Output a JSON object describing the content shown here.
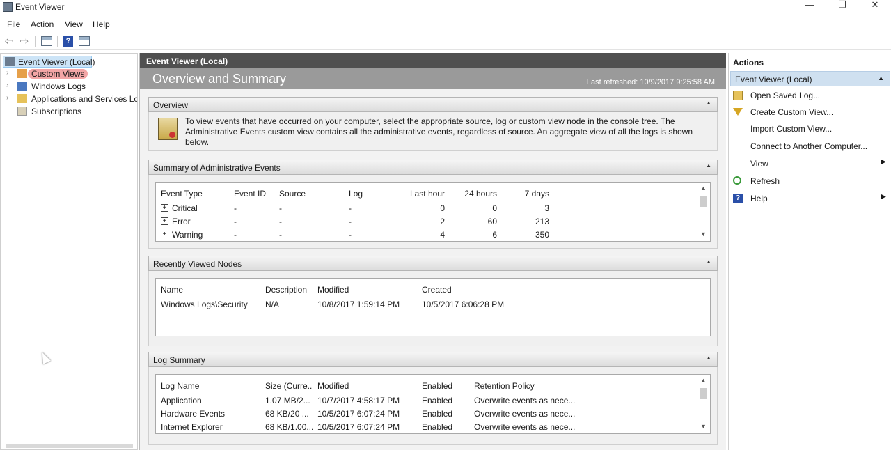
{
  "window": {
    "title": "Event Viewer",
    "minimize": "—",
    "restore": "❐",
    "close": "✕"
  },
  "menu": [
    "File",
    "Action",
    "View",
    "Help"
  ],
  "toolbar": {
    "back": "⇦",
    "forward": "⇨",
    "help": "?"
  },
  "tree": {
    "items": [
      {
        "label": "Event Viewer (Local)",
        "icon": "event-viewer-icon"
      },
      {
        "label": "Custom Views",
        "icon": "folder-icon"
      },
      {
        "label": "Windows Logs",
        "icon": "windows-logs-icon"
      },
      {
        "label": "Applications and Services Logs",
        "icon": "folder-icon"
      },
      {
        "label": "Subscriptions",
        "icon": "subscriptions-icon"
      }
    ],
    "expander": "›"
  },
  "center": {
    "header": "Event Viewer (Local)",
    "overview_title": "Overview and Summary",
    "last_refreshed": "Last refreshed: 10/9/2017 9:25:58 AM",
    "overview": {
      "title": "Overview",
      "text": "To view events that have occurred on your computer, select the appropriate source, log or custom view node in the console tree. The Administrative Events custom view contains all the administrative events, regardless of source. An aggregate view of all the logs is shown below."
    },
    "admin_events": {
      "title": "Summary of Administrative Events",
      "headers": [
        "Event Type",
        "Event ID",
        "Source",
        "Log",
        "Last hour",
        "24 hours",
        "7 days"
      ],
      "rows": [
        {
          "type": "Critical",
          "id": "-",
          "source": "-",
          "log": "-",
          "hour": "0",
          "day": "0",
          "week": "3"
        },
        {
          "type": "Error",
          "id": "-",
          "source": "-",
          "log": "-",
          "hour": "2",
          "day": "60",
          "week": "213"
        },
        {
          "type": "Warning",
          "id": "-",
          "source": "-",
          "log": "-",
          "hour": "4",
          "day": "6",
          "week": "350"
        }
      ]
    },
    "recent_nodes": {
      "title": "Recently Viewed Nodes",
      "headers": [
        "Name",
        "Description",
        "Modified",
        "Created"
      ],
      "rows": [
        {
          "name": "Windows Logs\\Security",
          "desc": "N/A",
          "modified": "10/8/2017 1:59:14 PM",
          "created": "10/5/2017 6:06:28 PM"
        }
      ]
    },
    "log_summary": {
      "title": "Log Summary",
      "headers": [
        "Log Name",
        "Size (Curre...",
        "Modified",
        "Enabled",
        "Retention Policy"
      ],
      "rows": [
        {
          "name": "Application",
          "size": "1.07 MB/2...",
          "modified": "10/7/2017 4:58:17 PM",
          "enabled": "Enabled",
          "policy": "Overwrite events as nece..."
        },
        {
          "name": "Hardware Events",
          "size": "68 KB/20 ...",
          "modified": "10/5/2017 6:07:24 PM",
          "enabled": "Enabled",
          "policy": "Overwrite events as nece..."
        },
        {
          "name": "Internet Explorer",
          "size": "68 KB/1.00...",
          "modified": "10/5/2017 6:07:24 PM",
          "enabled": "Enabled",
          "policy": "Overwrite events as nece..."
        }
      ]
    }
  },
  "actions": {
    "title": "Actions",
    "group": "Event Viewer (Local)",
    "items": [
      {
        "label": "Open Saved Log...",
        "icon": "folder-open-icon"
      },
      {
        "label": "Create Custom View...",
        "icon": "filter-icon"
      },
      {
        "label": "Import Custom View...",
        "icon": ""
      },
      {
        "label": "Connect to Another Computer...",
        "icon": ""
      },
      {
        "label": "View",
        "icon": "",
        "submenu": true
      },
      {
        "label": "Refresh",
        "icon": "refresh-icon"
      },
      {
        "label": "Help",
        "icon": "help-icon",
        "submenu": true
      }
    ]
  }
}
